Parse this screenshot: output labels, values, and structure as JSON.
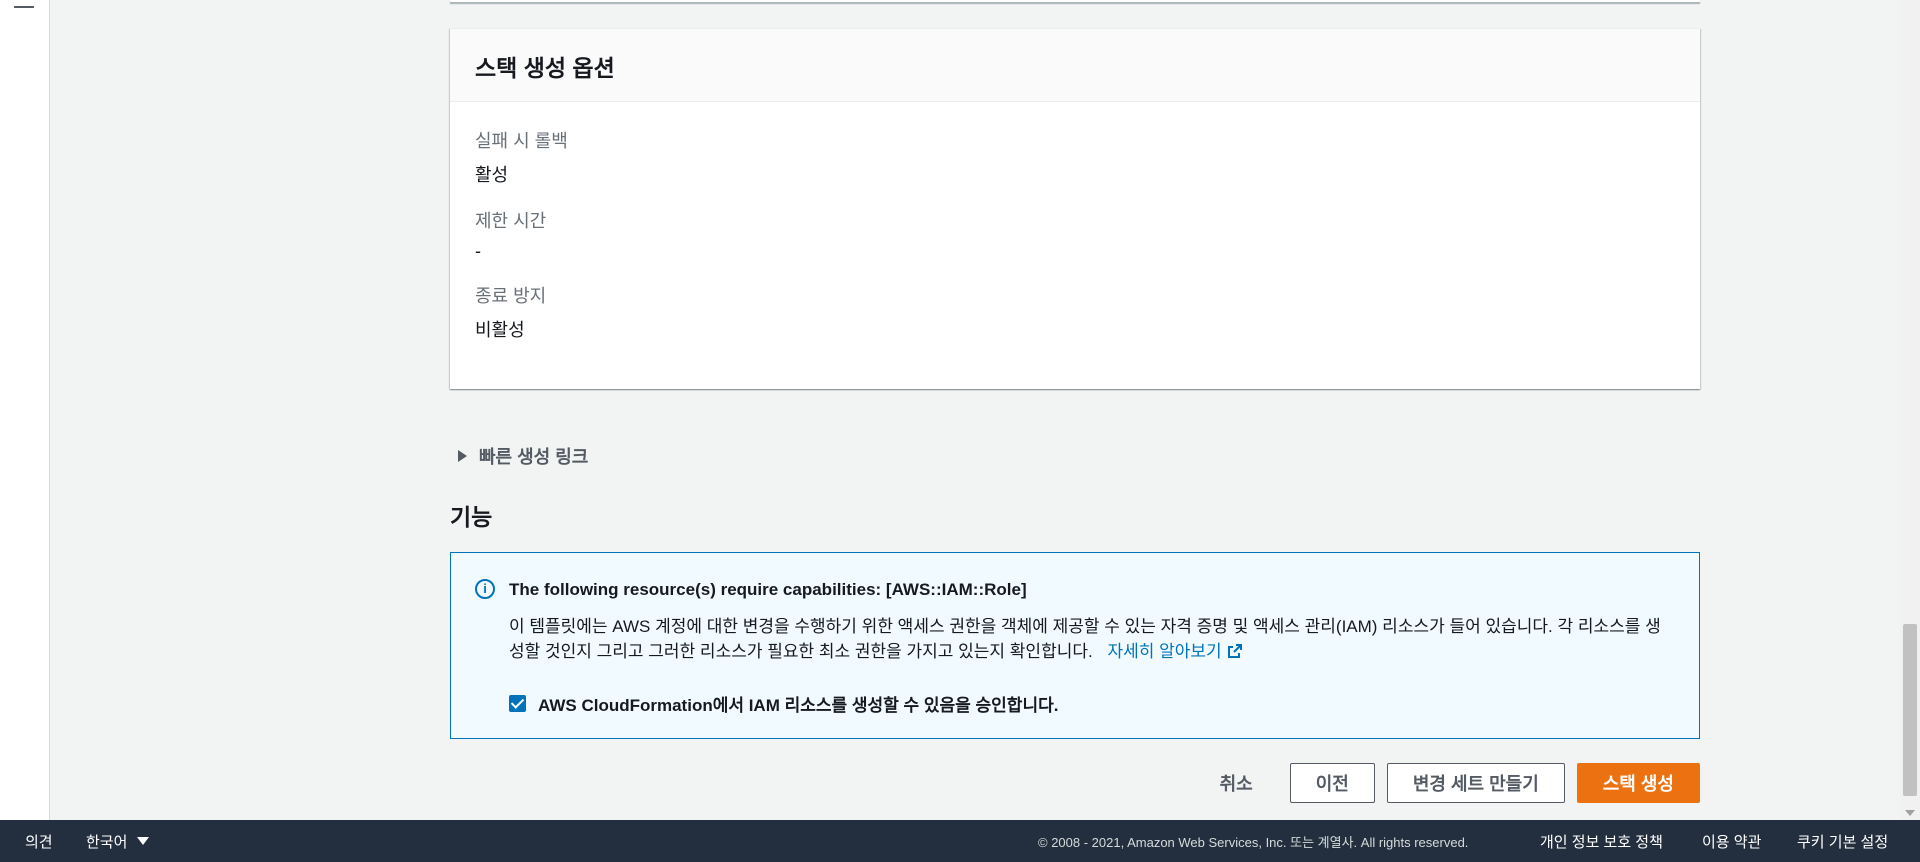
{
  "options_card": {
    "title": "스택 생성 옵션",
    "items": [
      {
        "label": "실패 시 롤백",
        "value": "활성"
      },
      {
        "label": "제한 시간",
        "value": "-"
      },
      {
        "label": "종료 방지",
        "value": "비활성"
      }
    ]
  },
  "quick_link": {
    "label": "빠른 생성 링크"
  },
  "capabilities": {
    "heading": "기능",
    "info_title": "The following resource(s) require capabilities: [AWS::IAM::Role]",
    "info_desc": "이 템플릿에는 AWS 계정에 대한 변경을 수행하기 위한 액세스 권한을 객체에 제공할 수 있는 자격 증명 및 액세스 관리(IAM) 리소스가 들어 있습니다. 각 리소스를 생성할 것인지 그리고 그러한 리소스가 필요한 최소 권한을 가지고 있는지 확인합니다.",
    "learn_more": "자세히 알아보기",
    "ack_label": "AWS CloudFormation에서 IAM 리소스를 생성할 수 있음을 승인합니다.",
    "ack_checked": true
  },
  "actions": {
    "cancel": "취소",
    "previous": "이전",
    "create_changeset": "변경 세트 만들기",
    "create_stack": "스택 생성"
  },
  "footer": {
    "feedback": "의견",
    "language": "한국어",
    "copyright": "© 2008 - 2021, Amazon Web Services, Inc. 또는 계열사. All rights reserved.",
    "privacy": "개인 정보 보호 정책",
    "terms": "이용 약관",
    "cookies": "쿠키 기본 설정"
  },
  "colors": {
    "primary_button": "#ec7211",
    "link": "#0073bb",
    "footer_bg": "#232f3e"
  }
}
